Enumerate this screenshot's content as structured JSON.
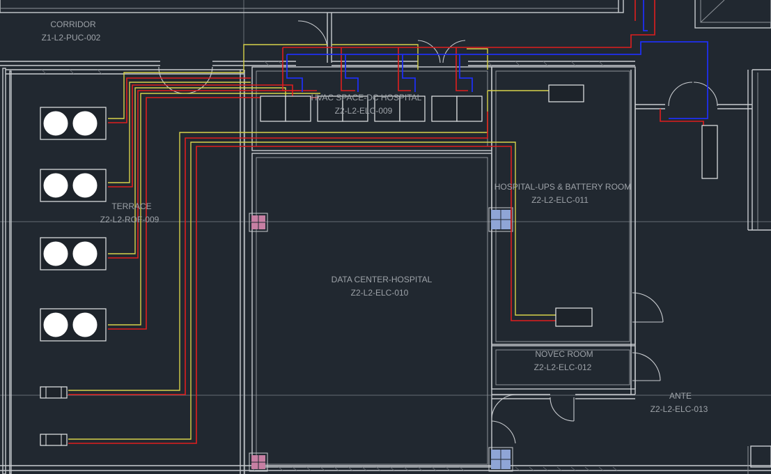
{
  "drawing": {
    "rooms": [
      {
        "id": "corridor",
        "name": "CORRIDOR",
        "code": "Z1-L2-PUC-002"
      },
      {
        "id": "terrace",
        "name": "TERRACE",
        "code": "Z2-L2-ROF-009"
      },
      {
        "id": "hvac",
        "name": "HVAC SPACE-DC HOSPITAL",
        "code": "Z2-L2-ELC-009"
      },
      {
        "id": "datacenter",
        "name": "DATA CENTER-HOSPITAL",
        "code": "Z2-L2-ELC-010"
      },
      {
        "id": "ups",
        "name": "HOSPITAL-UPS & BATTERY ROOM",
        "code": "Z2-L2-ELC-011"
      },
      {
        "id": "novec",
        "name": "NOVEC ROOM",
        "code": "Z2-L2-ELC-012"
      },
      {
        "id": "ante",
        "name": "ANTE",
        "code": "Z2-L2-ELC-013"
      }
    ],
    "colors": {
      "background": "#212830",
      "wall": "#c9ccd0",
      "refrigerant_liquid": "#e01e1e",
      "refrigerant_suction": "#1f2ff2",
      "control_cable": "#d8d24a",
      "column_pink": "#c77fa3",
      "column_blue": "#8fa5d6"
    }
  }
}
